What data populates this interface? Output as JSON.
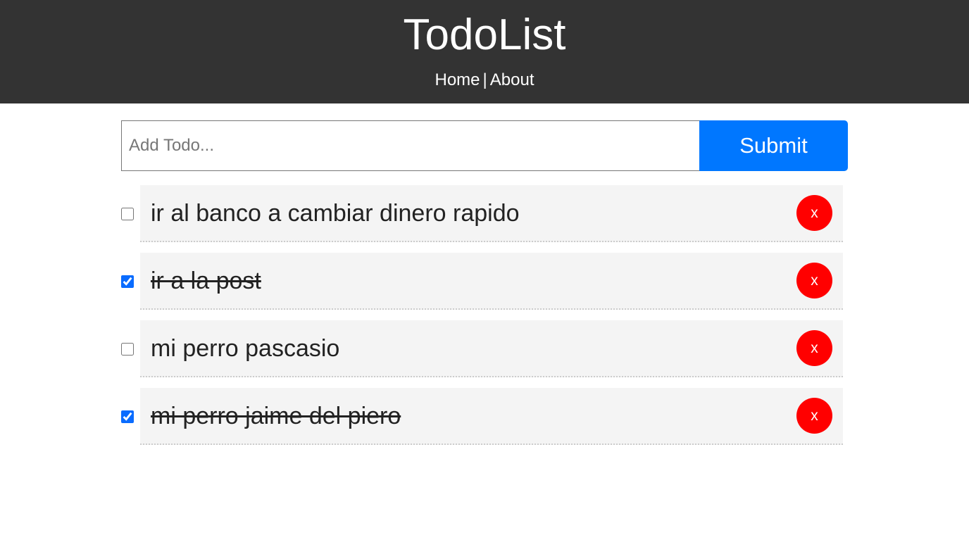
{
  "header": {
    "title": "TodoList",
    "nav": {
      "home": "Home",
      "separator": "|",
      "about": "About"
    }
  },
  "form": {
    "placeholder": "Add Todo...",
    "value": "",
    "submit_label": "Submit"
  },
  "todos": [
    {
      "title": "ir al banco a cambiar dinero rapido",
      "completed": false,
      "delete_label": "x"
    },
    {
      "title": "ir a la post",
      "completed": true,
      "delete_label": "x"
    },
    {
      "title": "mi perro pascasio",
      "completed": false,
      "delete_label": "x"
    },
    {
      "title": "mi perro jaime del piero",
      "completed": true,
      "delete_label": "x"
    }
  ],
  "colors": {
    "header_bg": "#333333",
    "submit_bg": "#0077ff",
    "delete_bg": "#ff0000",
    "item_bg": "#f4f4f4"
  }
}
